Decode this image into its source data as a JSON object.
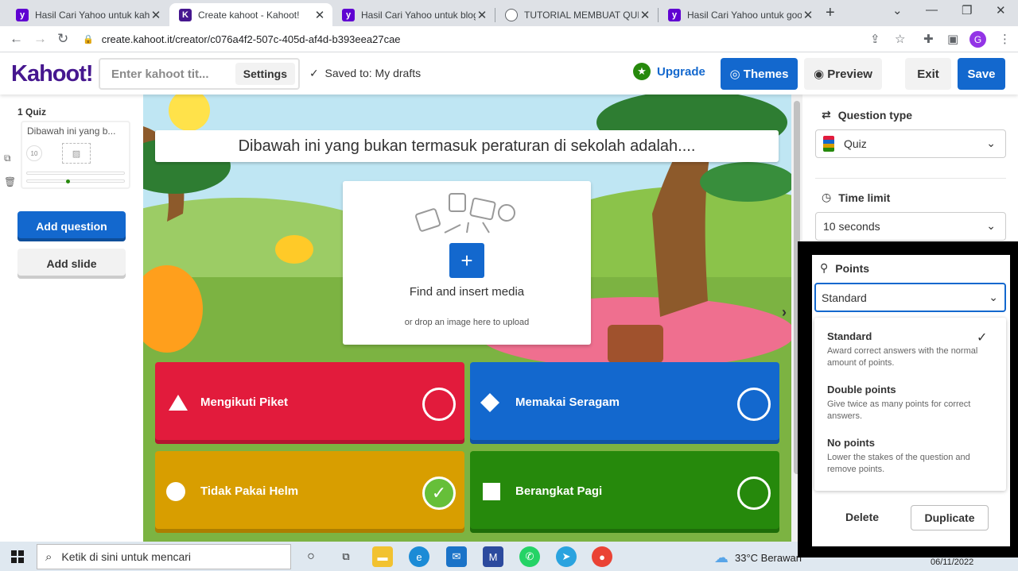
{
  "browser": {
    "tabs": [
      {
        "title": "Hasil Cari Yahoo untuk kahoo",
        "icon": "yahoo-icon",
        "active": false
      },
      {
        "title": "Create kahoot - Kahoot!",
        "icon": "kahoot-icon",
        "active": true
      },
      {
        "title": "Hasil Cari Yahoo untuk blog c",
        "icon": "yahoo-icon",
        "active": false
      },
      {
        "title": "TUTORIAL MEMBUAT QUIS O",
        "icon": "globe-icon",
        "active": false
      },
      {
        "title": "Hasil Cari Yahoo untuk goog",
        "icon": "yahoo-icon",
        "active": false
      }
    ],
    "url": "create.kahoot.it/creator/c076a4f2-507c-405d-af4d-b393eea27cae",
    "profile_initial": "G"
  },
  "header": {
    "logo": "Kahoot!",
    "title_placeholder": "Enter kahoot tit...",
    "settings": "Settings",
    "saved": "Saved to: My drafts",
    "upgrade": "Upgrade",
    "themes": "Themes",
    "preview": "Preview",
    "exit": "Exit",
    "save": "Save"
  },
  "sidebar": {
    "slide_label": "1  Quiz",
    "thumb_text": "Dibawah ini yang b...",
    "thumb_timer": "10",
    "add_question": "Add question",
    "add_slide": "Add slide"
  },
  "editor": {
    "question": "Dibawah ini yang bukan termasuk peraturan di sekolah adalah....",
    "media_find": "Find and insert media",
    "media_drop": "or drop an image here to upload",
    "answers": [
      {
        "text": "Mengikuti Piket",
        "color": "#e21b3c",
        "shape": "triangle",
        "correct": false
      },
      {
        "text": "Memakai Seragam",
        "color": "#1368ce",
        "shape": "diamond",
        "correct": false
      },
      {
        "text": "Tidak Pakai Helm",
        "color": "#d89e00",
        "shape": "circle",
        "correct": true
      },
      {
        "text": "Berangkat Pagi",
        "color": "#26890c",
        "shape": "square",
        "correct": false
      }
    ]
  },
  "settings_panel": {
    "question_type_label": "Question type",
    "question_type_value": "Quiz",
    "time_limit_label": "Time limit",
    "time_limit_value": "10 seconds",
    "points_label": "Points",
    "points_value": "Standard",
    "points_options": [
      {
        "name": "Standard",
        "desc": "Award correct answers with the normal amount of points.",
        "selected": true
      },
      {
        "name": "Double points",
        "desc": "Give twice as many points for correct answers.",
        "selected": false
      },
      {
        "name": "No points",
        "desc": "Lower the stakes of the question and remove points.",
        "selected": false
      }
    ],
    "delete": "Delete",
    "duplicate": "Duplicate"
  },
  "taskbar": {
    "search_placeholder": "Ketik di sini untuk mencari",
    "weather": "33°C  Berawan",
    "date": "06/11/2022"
  }
}
